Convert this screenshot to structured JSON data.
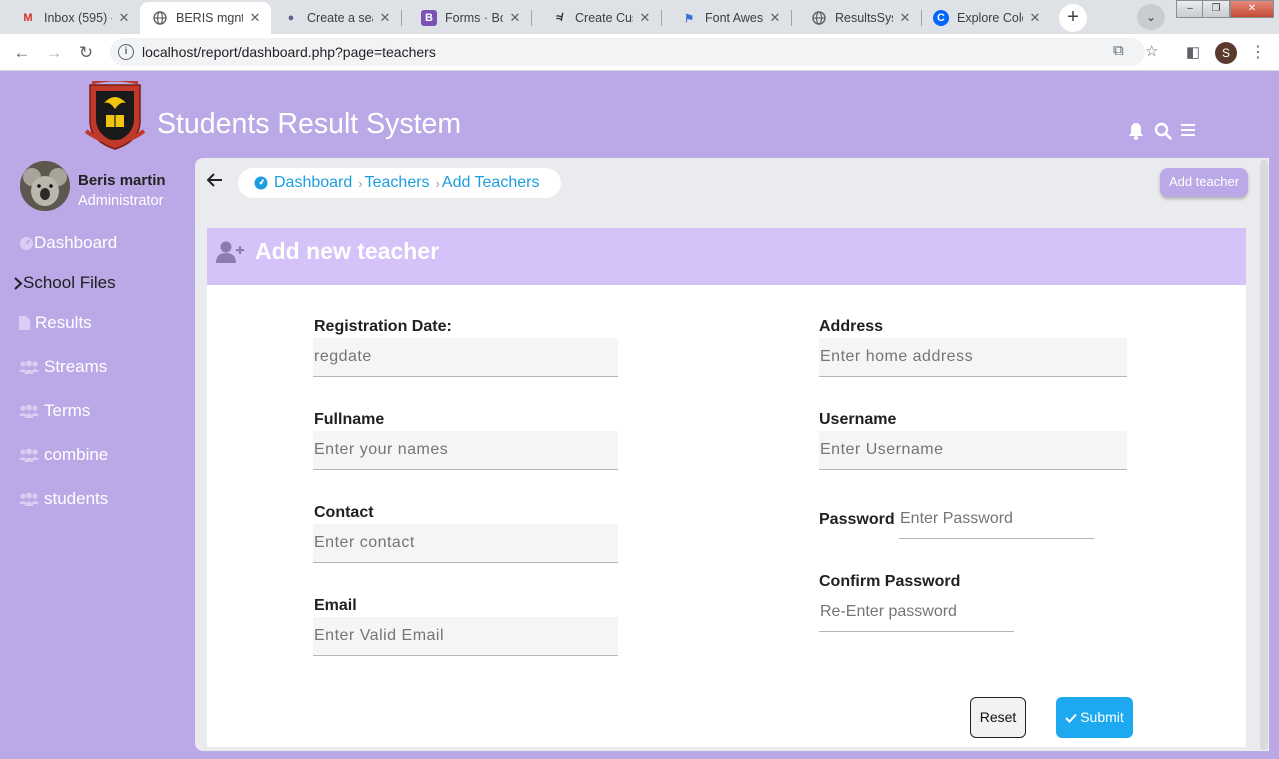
{
  "browser": {
    "tabs": [
      {
        "label": "Inbox (595) -",
        "favicon": "gmail-icon",
        "active": false
      },
      {
        "label": "BERIS mgnt",
        "favicon": "globe-icon",
        "active": true
      },
      {
        "label": "Create a sea",
        "favicon": "profile-icon",
        "active": false
      },
      {
        "label": "Forms · Boot",
        "favicon": "bootstrap-icon",
        "active": false
      },
      {
        "label": "Create Custo",
        "favicon": "wordpress-icon",
        "active": false
      },
      {
        "label": "Font Aweso",
        "favicon": "flag-icon",
        "active": false
      },
      {
        "label": "ResultsSys",
        "favicon": "globe-icon",
        "active": false
      },
      {
        "label": "Explore Colo",
        "favicon": "coolors-icon",
        "active": false
      }
    ],
    "url": "localhost/report/dashboard.php?page=teachers",
    "profile_initial": "S"
  },
  "app": {
    "title": "Students Result System"
  },
  "user": {
    "name": "Beris martin",
    "role": "Administrator"
  },
  "sidebar": {
    "items": [
      {
        "label": "Dashboard",
        "icon": "dashboard-icon"
      },
      {
        "label": "School Files",
        "icon": "chevron-right-icon"
      },
      {
        "label": "Results",
        "icon": "file-icon"
      },
      {
        "label": "Streams",
        "icon": "users-icon"
      },
      {
        "label": "Terms",
        "icon": "users-icon"
      },
      {
        "label": "combine",
        "icon": "users-icon"
      },
      {
        "label": "students",
        "icon": "users-icon"
      }
    ]
  },
  "breadcrumb": {
    "items": [
      "Dashboard",
      "Teachers",
      "Add Teachers"
    ]
  },
  "actions": {
    "add_teacher": "Add teacher",
    "reset": "Reset",
    "submit": "Submit"
  },
  "form": {
    "title": "Add new teacher",
    "fields": {
      "regdate": {
        "label": "Registration Date:",
        "placeholder": "regdate"
      },
      "fullname": {
        "label": "Fullname",
        "placeholder": "Enter your names"
      },
      "contact": {
        "label": "Contact",
        "placeholder": "Enter contact"
      },
      "email": {
        "label": "Email",
        "placeholder": "Enter Valid Email"
      },
      "address": {
        "label": "Address",
        "placeholder": "Enter home address"
      },
      "username": {
        "label": "Username",
        "placeholder": "Enter Username"
      },
      "password": {
        "label": "Password",
        "placeholder": "Enter Password"
      },
      "confirm": {
        "label": "Confirm Password",
        "placeholder": "Re-Enter password"
      }
    }
  },
  "colors": {
    "page_bg": "#bba8e6",
    "card_header": "#d4c2f8",
    "link": "#1a9ee0",
    "submit": "#1ca9f0"
  }
}
